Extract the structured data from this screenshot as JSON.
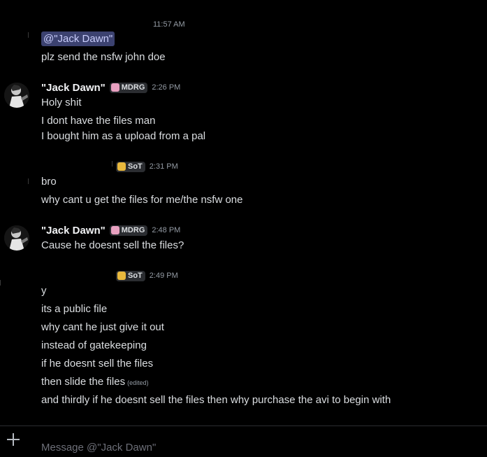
{
  "messages": {
    "m1": {
      "timestamp": "11:57 AM",
      "mention": "@\"Jack Dawn\"",
      "text": "plz send the nsfw john doe"
    },
    "g1": {
      "username": "\"Jack Dawn\"",
      "tag": "MDRG",
      "tag_icon": "cat-emoji-icon",
      "timestamp": "2:26 PM",
      "lines": [
        "Holy shit",
        "I dont have the files man",
        "I bought him as a upload from a pal"
      ]
    },
    "g2": {
      "tag": "SoT",
      "tag_icon": "skull-emoji-icon",
      "timestamp": "2:31 PM",
      "lines": [
        "bro",
        "why cant u get the files for me/the nsfw one"
      ]
    },
    "g3": {
      "username": "\"Jack Dawn\"",
      "tag": "MDRG",
      "tag_icon": "cat-emoji-icon",
      "timestamp": "2:48 PM",
      "lines": [
        "Cause he doesnt sell the files?"
      ]
    },
    "g4": {
      "tag": "SoT",
      "tag_icon": "skull-emoji-icon",
      "timestamp": "2:49 PM",
      "lines": [
        "y",
        "its a public file",
        "why cant he just give it out",
        "instead of gatekeeping",
        "if he doesnt sell the files",
        "then slide the files",
        "and thirdly if he doesnt sell the files then why purchase the avi to begin with"
      ],
      "edited_label": "(edited)"
    }
  },
  "composer": {
    "placeholder": "Message @\"Jack Dawn\""
  },
  "colors": {
    "background": "#000000",
    "mention_bg": "#3c4270",
    "mention_text": "#c9cdfb",
    "text": "#dbdee1",
    "muted": "#949ba4"
  }
}
